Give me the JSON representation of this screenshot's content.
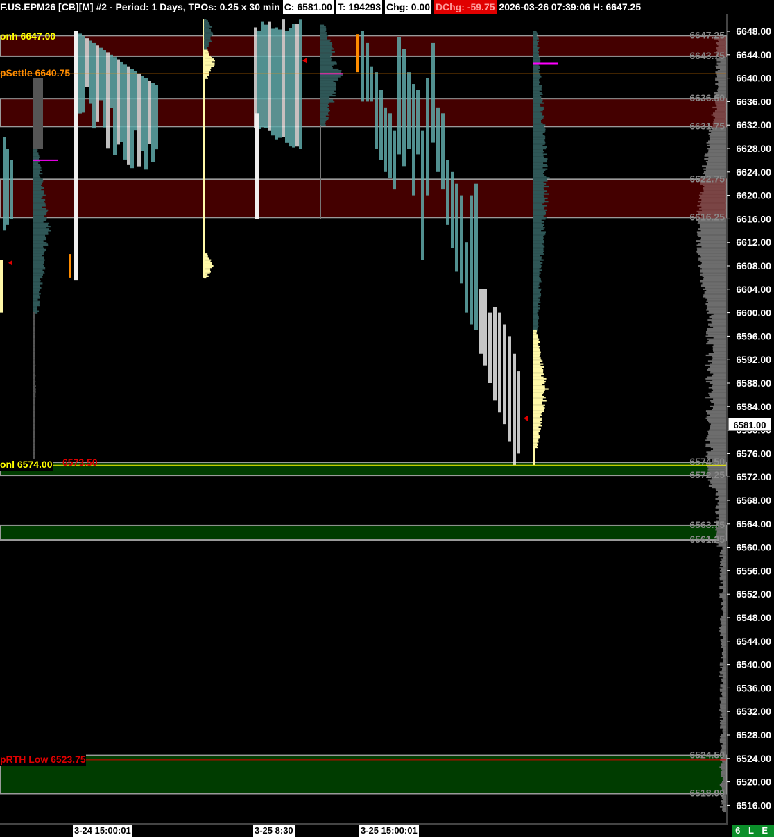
{
  "header": {
    "symbol": "F.US.EPM26 [CB][M] #2 - Period: 1 Days, TPOs: 0.25 x 30 min",
    "close": "C: 6581.00",
    "ticks": "T: 194293",
    "change": "Chg: 0.00",
    "daily_change": "DChg: -59.75",
    "datetime": "2026-03-26 07:39:06",
    "high": "H: 6647.25"
  },
  "price_tag": "6581.00",
  "status_badge": "6 L E",
  "colors": {
    "resistance_zone": "#440000",
    "support_zone": "#003c00",
    "tpo_teal": "#5fa9a9",
    "profile_dark": "#2f5757",
    "profile_yellow": "#fff8a8",
    "poc_magenta": "#ff00ff",
    "onh_yellow": "#ffff00",
    "settle_orange": "#ff8c00",
    "low_red": "#e00000"
  },
  "chart_data": {
    "type": "tpo_market_profile",
    "y_range": [
      6514.5,
      6650.5
    ],
    "y_ticks": [
      "6648.00",
      "6644.00",
      "6640.00",
      "6636.00",
      "6632.00",
      "6628.00",
      "6624.00",
      "6620.00",
      "6616.00",
      "6612.00",
      "6608.00",
      "6604.00",
      "6600.00",
      "6596.00",
      "6592.00",
      "6588.00",
      "6584.00",
      "6580.00",
      "6576.00",
      "6572.00",
      "6568.00",
      "6564.00",
      "6560.00",
      "6556.00",
      "6552.00",
      "6548.00",
      "6544.00",
      "6540.00",
      "6536.00",
      "6532.00",
      "6528.00",
      "6524.00",
      "6520.00",
      "6516.00"
    ],
    "time_labels": [
      "3-24  15:00:01",
      "3-25  8:30",
      "3-25  15:00:01"
    ],
    "current_price": 6581.0,
    "named_levels": [
      {
        "label": "onh",
        "value_text": "6647.00",
        "value": 6647.0,
        "color": "#ffff00"
      },
      {
        "label": "pSettle",
        "value_text": "6640.75",
        "value": 6640.75,
        "color": "#ff8c00"
      },
      {
        "label": "onl",
        "value_text": "6574.00",
        "value": 6574.0,
        "color": "#ffff00"
      },
      {
        "label": "pRTH Low",
        "value_text": "6523.75",
        "value": 6523.75,
        "color": "#e00000"
      }
    ],
    "extra_level_text": "6573.50",
    "zones": [
      {
        "type": "resistance",
        "top": 6647.25,
        "bottom": 6643.75
      },
      {
        "type": "resistance",
        "top": 6636.5,
        "bottom": 6631.75
      },
      {
        "type": "resistance",
        "top": 6622.75,
        "bottom": 6616.25
      },
      {
        "type": "support",
        "top": 6574.5,
        "bottom": 6572.25
      },
      {
        "type": "support",
        "top": 6563.75,
        "bottom": 6561.25
      },
      {
        "type": "support",
        "top": 6524.5,
        "bottom": 6518.0
      }
    ],
    "zone_labels": [
      "6647.25",
      "6643.75",
      "6636.50",
      "6631.75",
      "6622.75",
      "6616.25",
      "6574.50",
      "6572.25",
      "6563.75",
      "6561.25",
      "6524.50",
      "6518.00"
    ],
    "poc_levels": [
      6626.0,
      6640.75,
      6642.5
    ]
  }
}
